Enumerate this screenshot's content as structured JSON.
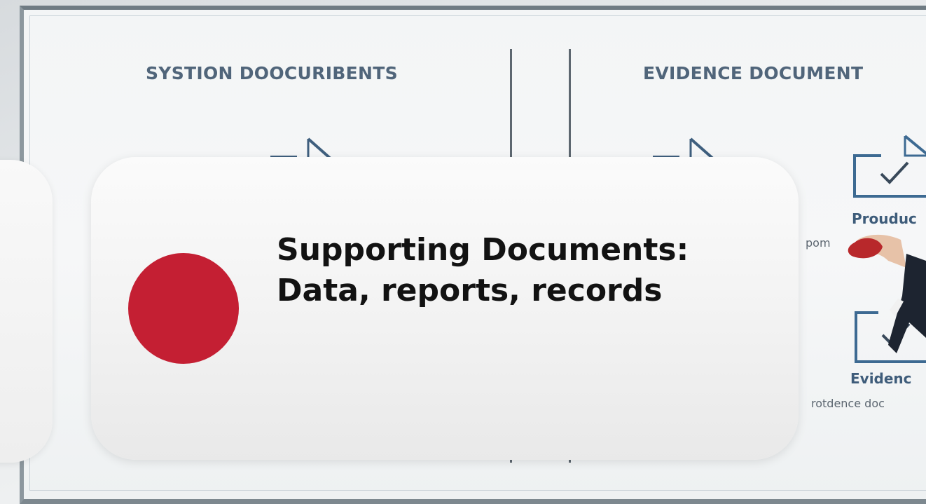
{
  "board": {
    "heading_left": "SYSTION DOOCURIBENTS",
    "heading_right": "EVIDENCE DOCUMENT",
    "card_top_label": "Prouduc",
    "card_top_sub": "pom",
    "card_bottom_label": "Evidenc",
    "card_bottom_sub": "rotdence doc"
  },
  "slide": {
    "bullet_color": "#c41f33",
    "text": "Supporting Documents: Data, reports, records"
  }
}
